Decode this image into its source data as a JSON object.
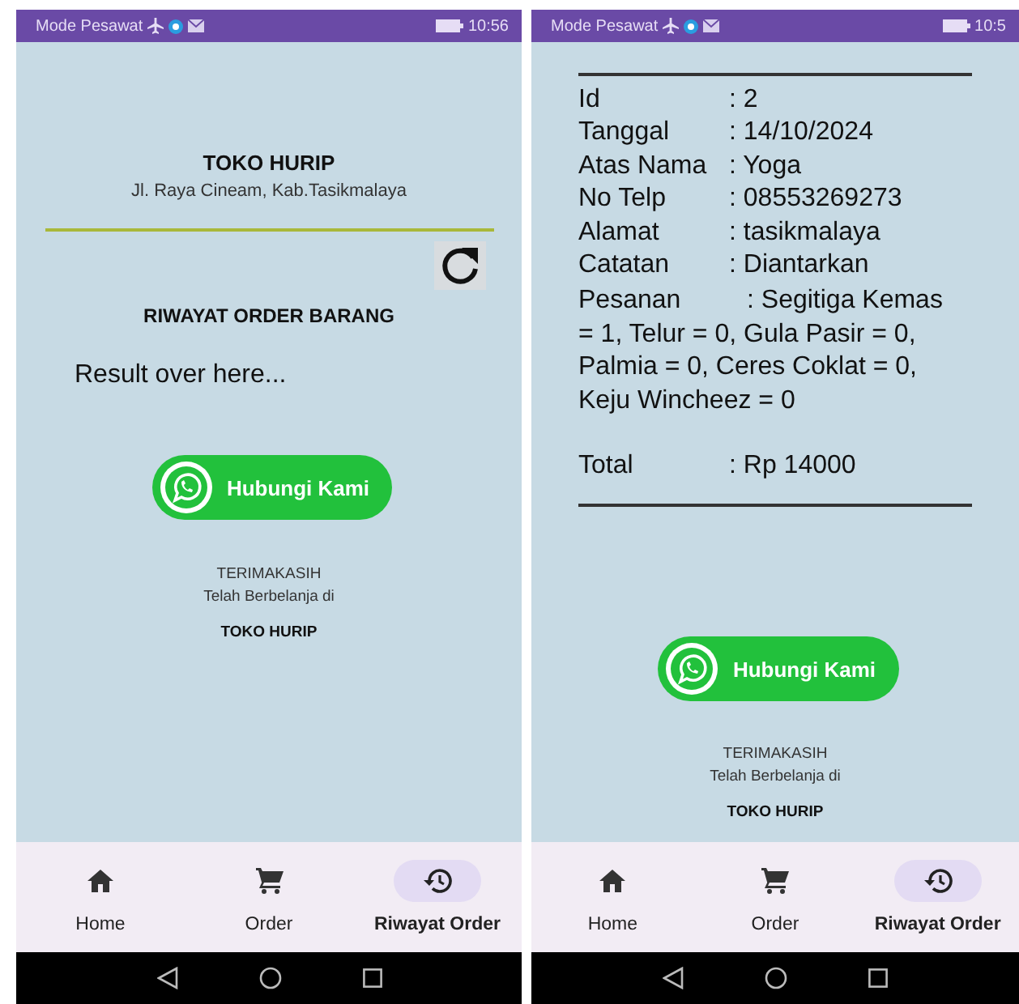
{
  "screens": [
    {
      "status_bar": {
        "carrier": "Mode Pesawat",
        "time": "10:56"
      },
      "content": [
        {
          "kind": "store_header",
          "name": "TOKO HURIP",
          "address": "Jl. Raya Cineam, Kab.Tasikmalaya"
        },
        {
          "kind": "refresh"
        },
        {
          "kind": "section_title",
          "text": "RIWAYAT ORDER BARANG"
        },
        {
          "kind": "result",
          "text": "Result over here..."
        },
        {
          "kind": "contact",
          "label": "Hubungi Kami"
        },
        {
          "kind": "thanks",
          "line1": "TERIMAKASIH",
          "line2": "Telah Berbelanja di",
          "store": "TOKO HURIP"
        }
      ],
      "nav": [
        {
          "label": "Home",
          "kind": "home",
          "selected": false
        },
        {
          "label": "Order",
          "kind": "cart",
          "selected": false
        },
        {
          "label": "Riwayat Order",
          "kind": "history",
          "selected": true
        }
      ]
    },
    {
      "status_bar": {
        "carrier": "Mode Pesawat",
        "time": "10:5"
      },
      "content": [
        {
          "kind": "receipt",
          "rows": [
            {
              "label": "Id",
              "value": ": 2"
            },
            {
              "label": "Tanggal",
              "value": ": 14/10/2024"
            },
            {
              "label": "Atas Nama",
              "value": ": Yoga"
            },
            {
              "label": "No Telp",
              "value": ": 08553269273"
            },
            {
              "label": "Alamat",
              "value": ": tasikmalaya"
            },
            {
              "label": "Catatan",
              "value": ": Diantarkan"
            },
            {
              "label": "Pesanan",
              "value": ": Segitiga Kemas"
            }
          ],
          "order_items": "= 1, Telur = 0, Gula Pasir = 0, Palmia = 0, Ceres Coklat = 0, Keju Wincheez = 0",
          "total_label": "Total",
          "total_value": ": Rp  14000"
        },
        {
          "kind": "contact",
          "label": "Hubungi Kami"
        },
        {
          "kind": "thanks",
          "line1": "TERIMAKASIH",
          "line2": "Telah Berbelanja di",
          "store": "TOKO HURIP"
        }
      ],
      "nav": [
        {
          "label": "Home",
          "kind": "home",
          "selected": false
        },
        {
          "label": "Order",
          "kind": "cart",
          "selected": false
        },
        {
          "label": "Riwayat Order",
          "kind": "history",
          "selected": true
        }
      ]
    }
  ]
}
